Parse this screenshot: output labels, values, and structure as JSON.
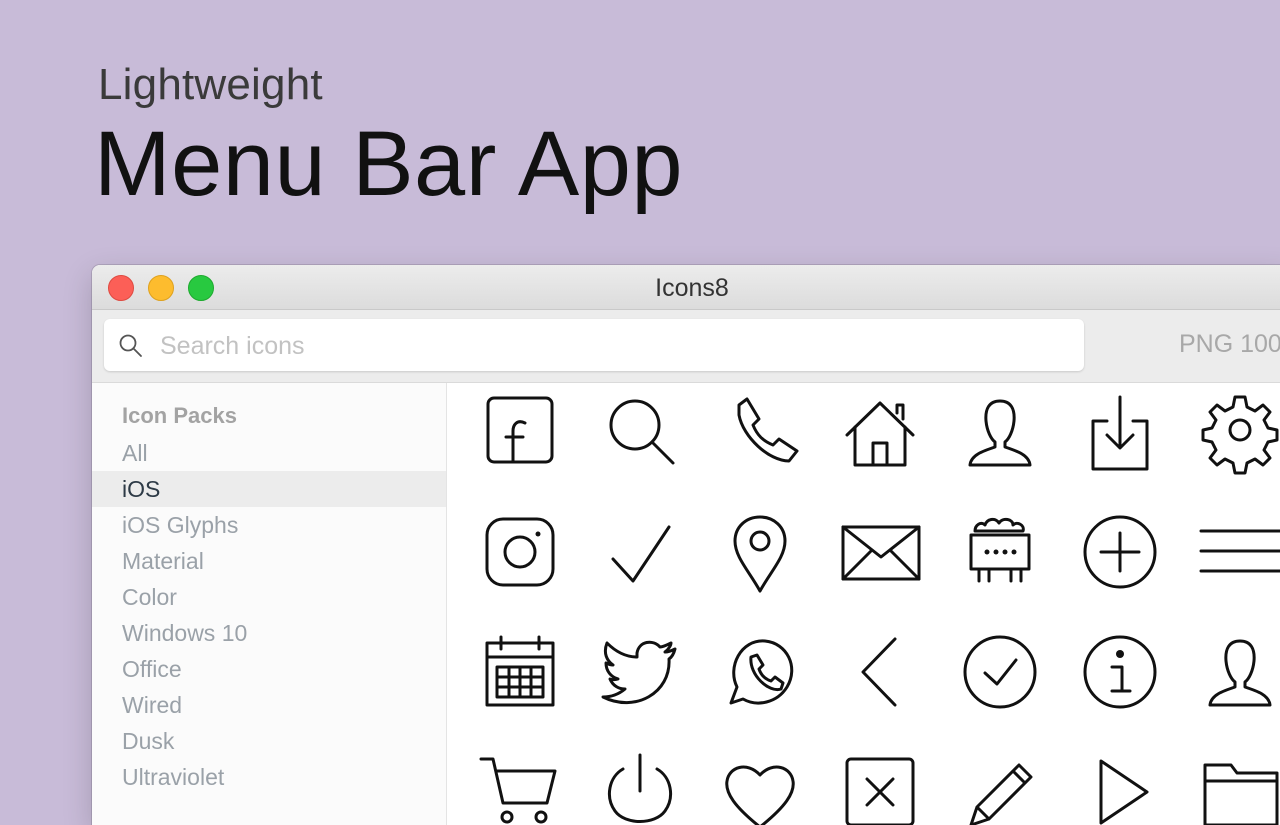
{
  "hero": {
    "subtitle": "Lightweight",
    "title": "Menu Bar App"
  },
  "window": {
    "title": "Icons8"
  },
  "search": {
    "placeholder": "Search icons",
    "value": ""
  },
  "toolbar": {
    "format_label": "PNG 100"
  },
  "sidebar": {
    "heading": "Icon Packs",
    "selected": "iOS",
    "items": [
      {
        "label": "All"
      },
      {
        "label": "iOS"
      },
      {
        "label": "iOS Glyphs"
      },
      {
        "label": "Material"
      },
      {
        "label": "Color"
      },
      {
        "label": "Windows 10"
      },
      {
        "label": "Office"
      },
      {
        "label": "Wired"
      },
      {
        "label": "Dusk"
      },
      {
        "label": "Ultraviolet"
      }
    ]
  },
  "colors": {
    "background": "#c8bbd8",
    "close": "#fc5f57",
    "minimize": "#fdbc2e",
    "maximize": "#28c940",
    "selected_row": "#ececec"
  },
  "icon_grid": [
    [
      "facebook-icon",
      "search-icon",
      "phone-icon",
      "home-icon",
      "user-icon",
      "download-icon",
      "settings-icon"
    ],
    [
      "instagram-icon",
      "checkmark-icon",
      "location-pin-icon",
      "mail-icon",
      "network-card-icon",
      "add-circle-icon",
      "menu-icon"
    ],
    [
      "calendar-icon",
      "twitter-icon",
      "whatsapp-icon",
      "chevron-left-icon",
      "checked-circle-icon",
      "info-icon",
      "user-icon"
    ],
    [
      "shopping-cart-icon",
      "power-icon",
      "heart-icon",
      "close-box-icon",
      "pencil-icon",
      "play-icon",
      "folder-icon"
    ]
  ]
}
